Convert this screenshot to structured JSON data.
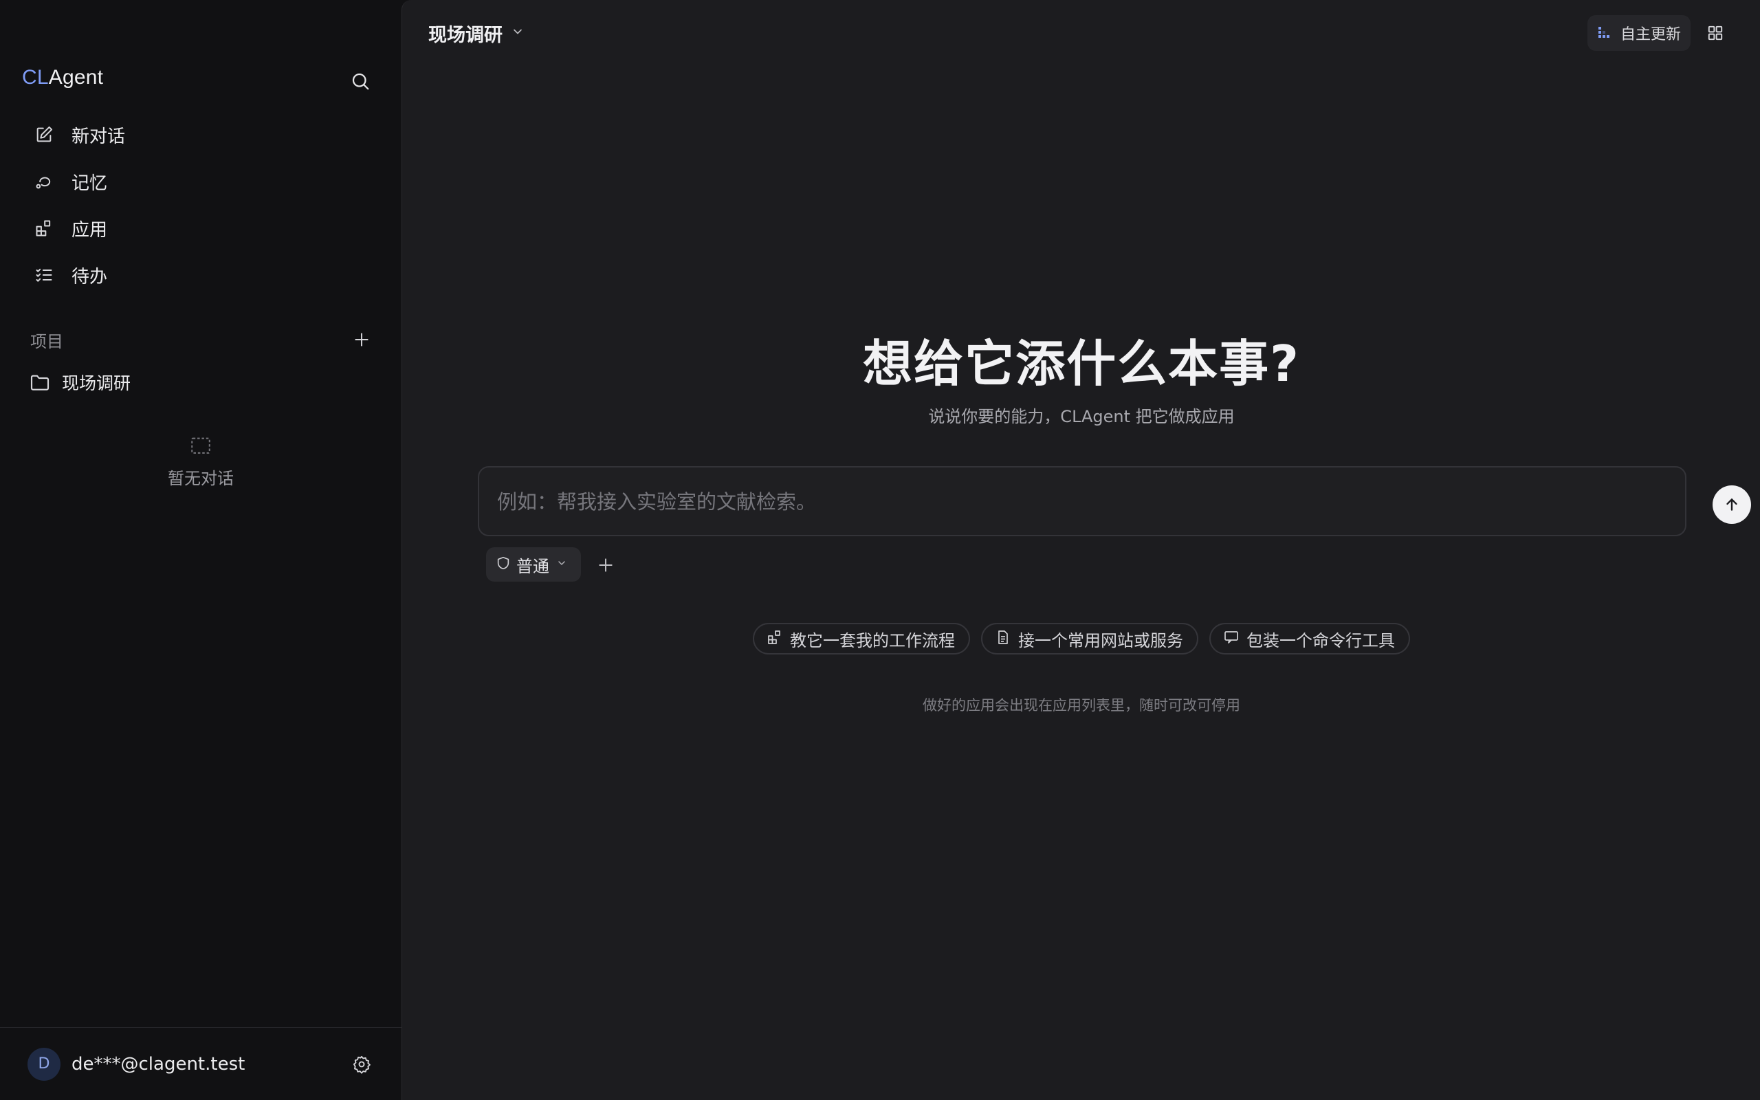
{
  "sidebar": {
    "brand": {
      "prefix": "CL",
      "suffix": "Agent",
      "accent": "#7f9cf5"
    },
    "search_icon": "search-icon",
    "nav": [
      {
        "label": "新对话",
        "icon": "edit-icon"
      },
      {
        "label": "记忆",
        "icon": "memory-icon"
      },
      {
        "label": "应用",
        "icon": "apps-icon"
      },
      {
        "label": "待办",
        "icon": "checklist-icon"
      }
    ],
    "projects_label": "项目",
    "projects": [
      {
        "label": "现场调研",
        "icon": "folder-icon"
      }
    ],
    "empty_label": "暂无对话",
    "user": {
      "initial": "D",
      "email": "de***@clagent.test"
    }
  },
  "main": {
    "project_title": "现场调研",
    "auto_update_label": "自主更新",
    "hero_title": "想给它添什么本事?",
    "hero_subtitle": "说说你要的能力，CLAgent 把它做成应用",
    "input_placeholder": "例如：帮我接入实验室的文献检索。",
    "mode_label": "普通",
    "suggestions": [
      {
        "label": "教它一套我的工作流程",
        "icon": "apps-icon"
      },
      {
        "label": "接一个常用网站或服务",
        "icon": "document-icon"
      },
      {
        "label": "包装一个命令行工具",
        "icon": "terminal-icon"
      }
    ],
    "footer_note": "做好的应用会出现在应用列表里，随时可改可停用"
  }
}
